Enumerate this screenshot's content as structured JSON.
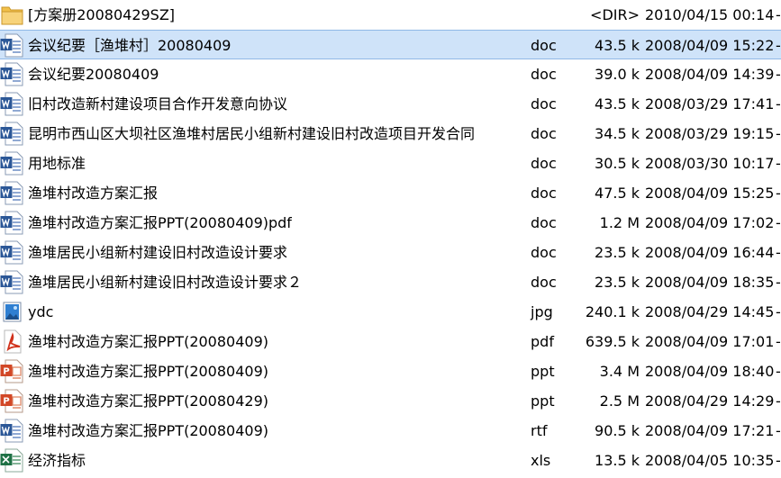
{
  "files": [
    {
      "icon": "folder-icon",
      "name": "[方案册20080429SZ]",
      "ext": "",
      "size": "<DIR>",
      "date": "2010/04/15 00:14",
      "mark": "-",
      "selected": false
    },
    {
      "icon": "word-document-icon",
      "name": "会议纪要［渔堆村］20080409",
      "ext": "doc",
      "size": "43.5 k",
      "date": "2008/04/09 15:22",
      "mark": "-",
      "selected": true
    },
    {
      "icon": "word-document-icon",
      "name": "会议纪要20080409",
      "ext": "doc",
      "size": "39.0 k",
      "date": "2008/04/09 14:39",
      "mark": "-",
      "selected": false
    },
    {
      "icon": "word-document-icon",
      "name": "旧村改造新村建设项目合作开发意向协议",
      "ext": "doc",
      "size": "43.5 k",
      "date": "2008/03/29 17:41",
      "mark": "-",
      "selected": false
    },
    {
      "icon": "word-document-icon",
      "name": "昆明市西山区大坝社区渔堆村居民小组新村建设旧村改造项目开发合同",
      "ext": "doc",
      "size": "34.5 k",
      "date": "2008/03/29 19:15",
      "mark": "-",
      "selected": false
    },
    {
      "icon": "word-document-icon",
      "name": "用地标准",
      "ext": "doc",
      "size": "30.5 k",
      "date": "2008/03/30 10:17",
      "mark": "-",
      "selected": false
    },
    {
      "icon": "word-document-icon",
      "name": "渔堆村改造方案汇报",
      "ext": "doc",
      "size": "47.5 k",
      "date": "2008/04/09 15:25",
      "mark": "-",
      "selected": false
    },
    {
      "icon": "word-document-icon",
      "name": "渔堆村改造方案汇报PPT(20080409)pdf",
      "ext": "doc",
      "size": "1.2 M",
      "date": "2008/04/09 17:02",
      "mark": "-",
      "selected": false
    },
    {
      "icon": "word-document-icon",
      "name": "渔堆居民小组新村建设旧村改造设计要求",
      "ext": "doc",
      "size": "23.5 k",
      "date": "2008/04/09 16:44",
      "mark": "-",
      "selected": false
    },
    {
      "icon": "word-document-icon",
      "name": "渔堆居民小组新村建设旧村改造设计要求２",
      "ext": "doc",
      "size": "23.5 k",
      "date": "2008/04/09 18:35",
      "mark": "-",
      "selected": false
    },
    {
      "icon": "image-file-icon",
      "name": "ydc",
      "ext": "jpg",
      "size": "240.1 k",
      "date": "2008/04/29 14:45",
      "mark": "-",
      "selected": false
    },
    {
      "icon": "pdf-file-icon",
      "name": "渔堆村改造方案汇报PPT(20080409)",
      "ext": "pdf",
      "size": "639.5 k",
      "date": "2008/04/09 17:01",
      "mark": "-",
      "selected": false
    },
    {
      "icon": "powerpoint-file-icon",
      "name": "渔堆村改造方案汇报PPT(20080409)",
      "ext": "ppt",
      "size": "3.4 M",
      "date": "2008/04/09 18:40",
      "mark": "-",
      "selected": false
    },
    {
      "icon": "powerpoint-file-icon",
      "name": "渔堆村改造方案汇报PPT(20080429)",
      "ext": "ppt",
      "size": "2.5 M",
      "date": "2008/04/29 14:29",
      "mark": "-",
      "selected": false
    },
    {
      "icon": "word-document-icon",
      "name": "渔堆村改造方案汇报PPT(20080409)",
      "ext": "rtf",
      "size": "90.5 k",
      "date": "2008/04/09 17:21",
      "mark": "-",
      "selected": false
    },
    {
      "icon": "excel-file-icon",
      "name": "经济指标",
      "ext": "xls",
      "size": "13.5 k",
      "date": "2008/04/05 10:35",
      "mark": "-",
      "selected": false
    }
  ],
  "colors": {
    "selection": "#cfe3f9",
    "selection_border": "#8fb8e6",
    "folder": "#f2c04a",
    "word": "#2b5797",
    "pdf": "#d0321c",
    "powerpoint": "#d24726",
    "excel": "#1e7145",
    "image": "#2f7fd1"
  }
}
